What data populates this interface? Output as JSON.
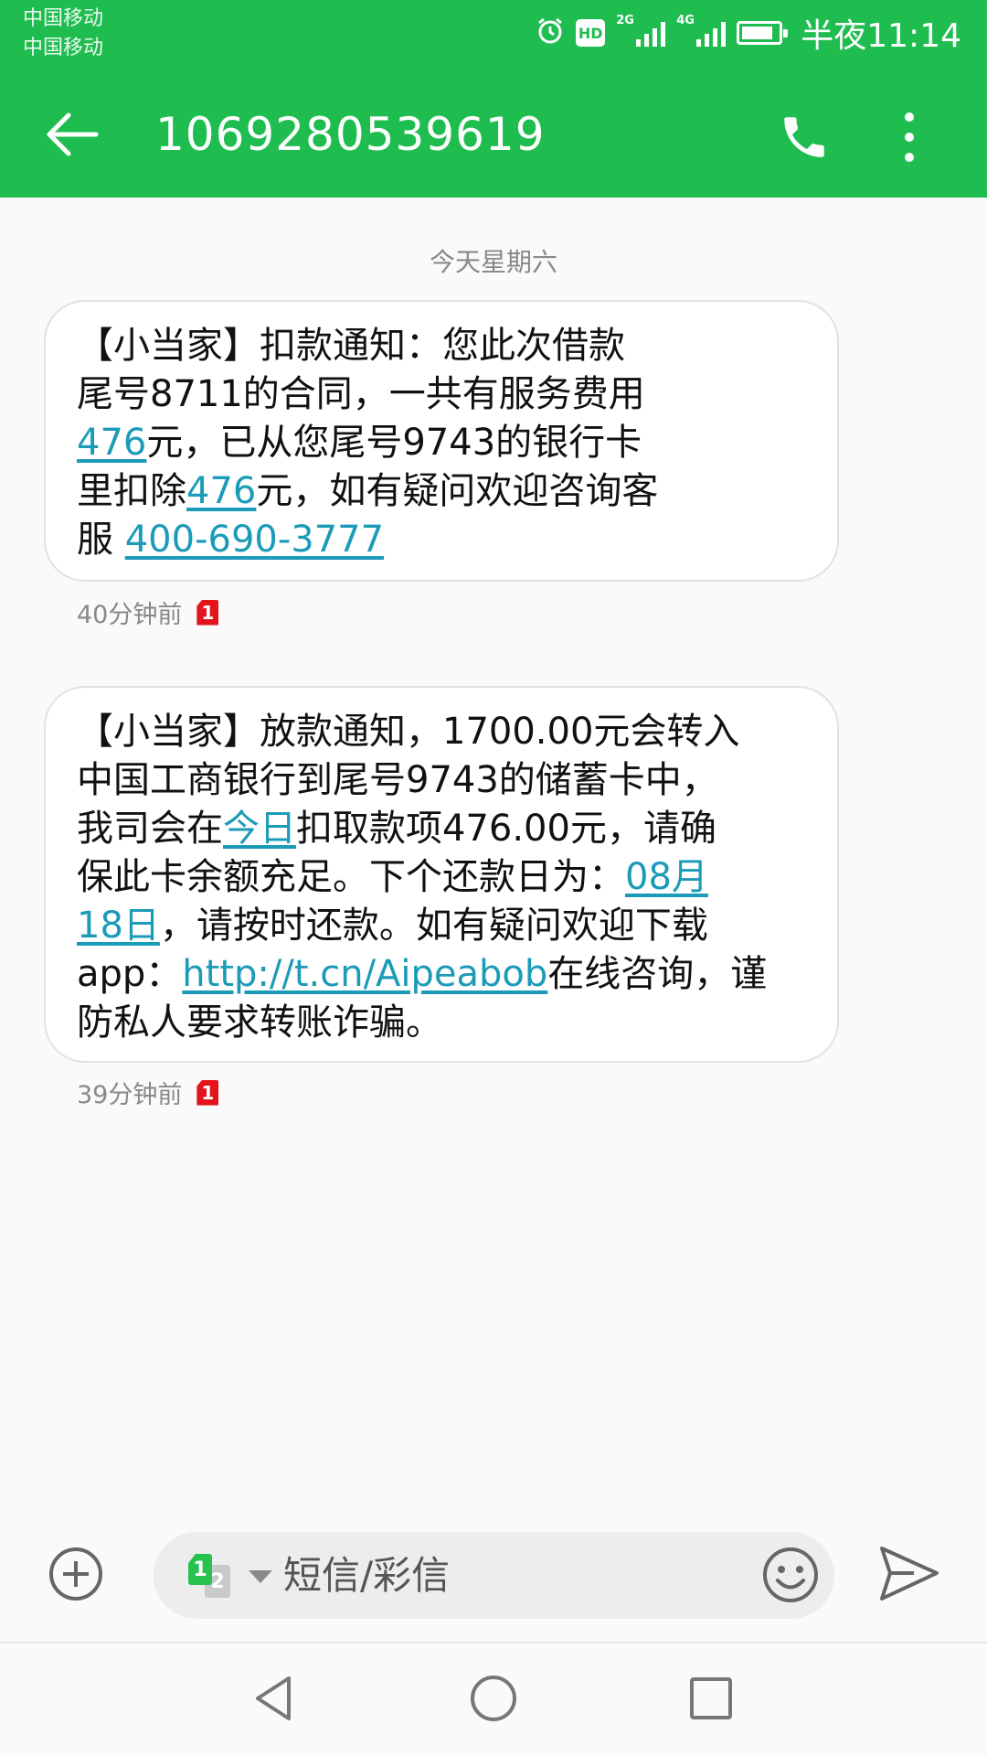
{
  "status_bar": {
    "carrier_1": "中国移动",
    "carrier_2": "中国移动",
    "hd_label": "HD",
    "net_1": "2G",
    "net_2": "4G",
    "time": "半夜11:14",
    "icons": [
      "alarm-icon",
      "hd-icon",
      "signal-icon",
      "battery-icon"
    ]
  },
  "header": {
    "title": "1069280539619",
    "icons": [
      "back-arrow-icon",
      "phone-icon",
      "more-vertical-icon"
    ],
    "accent_color": "#1fbd4f"
  },
  "conversation": {
    "day_label": "今天星期六",
    "messages": [
      {
        "lines": [
          [
            {
              "t": "【小当家】扣款通知：您此次借款"
            }
          ],
          [
            {
              "t": "尾号8711的合同，一共有服务费用"
            }
          ],
          [
            {
              "t": "476",
              "link": true
            },
            {
              "t": "元，已从您尾号9743的银行卡"
            }
          ],
          [
            {
              "t": "里扣除"
            },
            {
              "t": "476",
              "link": true
            },
            {
              "t": "元，如有疑问欢迎咨询客"
            }
          ],
          [
            {
              "t": "服 "
            },
            {
              "t": "400-690-3777",
              "link": true
            }
          ]
        ],
        "time": "40分钟前",
        "sim": "1"
      },
      {
        "lines": [
          [
            {
              "t": "【小当家】放款通知，1700.00元会转入"
            }
          ],
          [
            {
              "t": "中国工商银行到尾号9743的储蓄卡中，"
            }
          ],
          [
            {
              "t": "我司会在"
            },
            {
              "t": "今日",
              "link": true
            },
            {
              "t": "扣取款项476.00元，请确"
            }
          ],
          [
            {
              "t": "保此卡余额充足。下个还款日为："
            },
            {
              "t": "08月",
              "link": true
            }
          ],
          [
            {
              "t": "18日",
              "link": true
            },
            {
              "t": "，请按时还款。如有疑问欢迎下载"
            }
          ],
          [
            {
              "t": "app："
            },
            {
              "t": "http://t.cn/Aipeabob",
              "link": true
            },
            {
              "t": "在线咨询，谨"
            }
          ],
          [
            {
              "t": "防私人要求转账诈骗。"
            }
          ]
        ],
        "time": "39分钟前",
        "sim": "1"
      }
    ],
    "link_color": "#1b9bb8"
  },
  "composer": {
    "placeholder": "短信/彩信",
    "sim_primary": "1",
    "sim_secondary": "2",
    "icons": [
      "add-icon",
      "sim-switch-icon",
      "dropdown-caret-icon",
      "emoji-icon",
      "send-icon"
    ]
  },
  "nav_bar": {
    "icons": [
      "nav-back-icon",
      "nav-home-icon",
      "nav-recents-icon"
    ]
  }
}
